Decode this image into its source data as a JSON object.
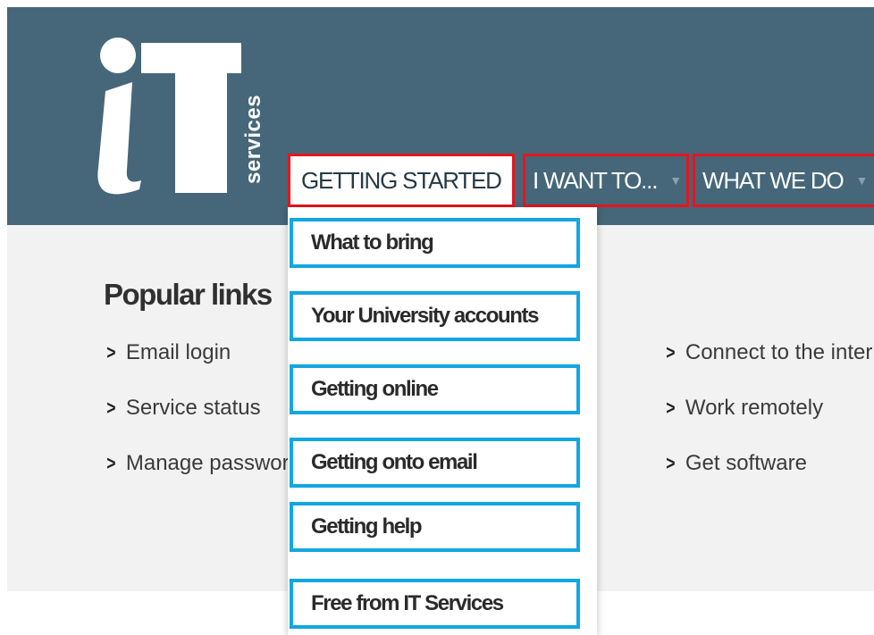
{
  "logo": {
    "text": "services"
  },
  "nav": {
    "getting_started": "GETTING STARTED",
    "i_want_to": "I WANT TO...",
    "what_we_do": "WHAT WE DO"
  },
  "popular": {
    "title": "Popular links",
    "left_links": [
      "Email login",
      "Service status",
      "Manage passwords"
    ],
    "right_links": [
      "Connect to the internet",
      "Work remotely",
      "Get software"
    ]
  },
  "dropdown": {
    "items": [
      "What to bring",
      "Your University accounts",
      "Getting online",
      "Getting onto email",
      "Getting help",
      "Free from IT Services"
    ]
  },
  "colors": {
    "header_bg": "#456779",
    "content_bg": "#f2f2f2",
    "nav_highlight": "#e8141d",
    "dropdown_highlight": "#12a6e2"
  }
}
